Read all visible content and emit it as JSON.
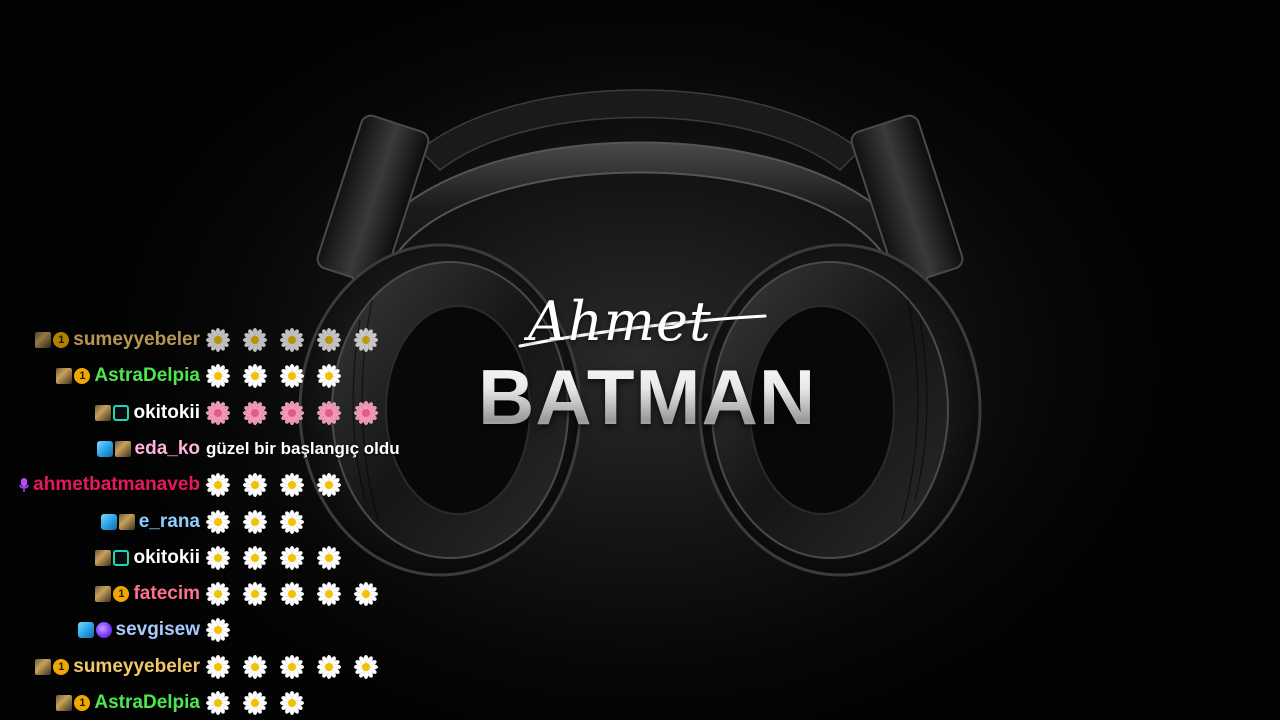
{
  "logo": {
    "script": "Ahmet",
    "block": "BATMAN"
  },
  "colors": {
    "background": "#050505",
    "sumeyyebeler": "#f2c76b",
    "AstraDelpia": "#4ee64e",
    "okitokii": "#ffffff",
    "eda_ko": "#ffb3d9",
    "ahmetbatmanaveb": "#e8195a",
    "e_rana": "#8fd0ff",
    "fatecim": "#ff6f8f",
    "sevgisew": "#a9c9ff",
    "daisy_petal": "#ffffff",
    "daisy_center": "#f2c200",
    "pink_petal": "#f48fb1"
  },
  "chat": {
    "rows": [
      {
        "username": "sumeyyebeler",
        "badges": [
          "sub-badge",
          "gift-badge-1"
        ],
        "emotes": [
          "daisy",
          "daisy",
          "daisy",
          "daisy",
          "daisy"
        ],
        "message": ""
      },
      {
        "username": "AstraDelpia",
        "badges": [
          "sub-badge",
          "gift-badge-1"
        ],
        "emotes": [
          "daisy",
          "daisy",
          "daisy",
          "daisy"
        ],
        "message": ""
      },
      {
        "username": "okitokii",
        "badges": [
          "sub-badge",
          "grid-badge"
        ],
        "emotes": [
          "pink-flower",
          "pink-flower",
          "pink-flower",
          "pink-flower",
          "pink-flower"
        ],
        "message": ""
      },
      {
        "username": "eda_ko",
        "badges": [
          "cube-badge",
          "sub-badge"
        ],
        "emotes": [],
        "message": "güzel bir başlangıç oldu"
      },
      {
        "username": "ahmetbatmanaveb",
        "badges": [
          "mic-badge"
        ],
        "emotes": [
          "daisy",
          "daisy",
          "daisy",
          "daisy"
        ],
        "message": ""
      },
      {
        "username": "e_rana",
        "badges": [
          "cube-badge",
          "sub-badge"
        ],
        "emotes": [
          "daisy",
          "daisy",
          "daisy"
        ],
        "message": ""
      },
      {
        "username": "okitokii",
        "badges": [
          "sub-badge",
          "grid-badge"
        ],
        "emotes": [
          "daisy",
          "daisy",
          "daisy",
          "daisy"
        ],
        "message": ""
      },
      {
        "username": "fatecim",
        "badges": [
          "sub-badge",
          "gift-badge-1"
        ],
        "emotes": [
          "daisy",
          "daisy",
          "daisy",
          "daisy",
          "daisy"
        ],
        "message": ""
      },
      {
        "username": "sevgisew",
        "badges": [
          "cube-badge",
          "heart-badge"
        ],
        "emotes": [
          "daisy"
        ],
        "message": ""
      },
      {
        "username": "sumeyyebeler",
        "badges": [
          "sub-badge",
          "gift-badge-1"
        ],
        "emotes": [
          "daisy",
          "daisy",
          "daisy",
          "daisy",
          "daisy"
        ],
        "message": ""
      },
      {
        "username": "AstraDelpia",
        "badges": [
          "sub-badge",
          "gift-badge-1"
        ],
        "emotes": [
          "daisy",
          "daisy",
          "daisy"
        ],
        "message": ""
      }
    ],
    "gift_badge_text": "1"
  }
}
